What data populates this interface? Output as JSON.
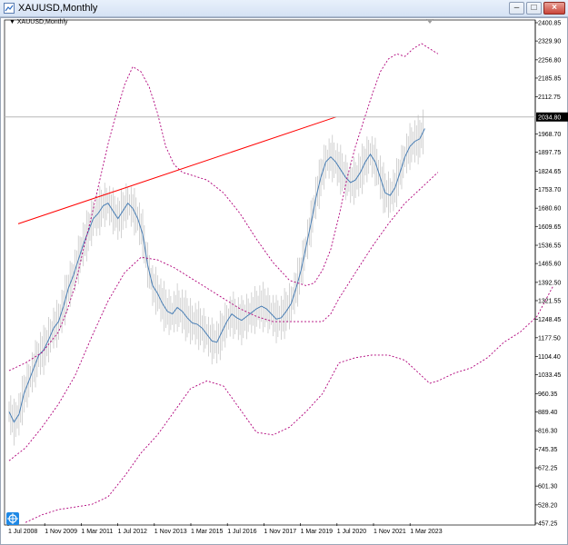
{
  "window": {
    "title": "XAUUSD,Monthly",
    "buttons": [
      "minimize",
      "restore",
      "close"
    ]
  },
  "chart_header": {
    "label": "XAUUSD,Monthly"
  },
  "current_price": "2034.80",
  "chart_data": {
    "type": "line",
    "y_ticks": [
      "2400.85",
      "2329.90",
      "2256.80",
      "2185.85",
      "2112.75",
      "1968.70",
      "1897.75",
      "1824.65",
      "1753.70",
      "1680.60",
      "1609.65",
      "1536.55",
      "1465.60",
      "1392.50",
      "1321.55",
      "1248.45",
      "1177.50",
      "1104.40",
      "1033.45",
      "960.35",
      "889.40",
      "816.30",
      "745.35",
      "672.25",
      "601.30",
      "528.20",
      "457.25"
    ],
    "x_ticks": [
      "1 Jul 2008",
      "1 Nov 2009",
      "1 Mar 2011",
      "1 Jul 2012",
      "1 Nov 2013",
      "1 Mar 2015",
      "1 Jul 2016",
      "1 Nov 2017",
      "1 Mar 2019",
      "1 Jul 2020",
      "1 Nov 2021",
      "1 Mar 2023"
    ],
    "ylim": [
      457.25,
      2400.85
    ],
    "colors": {
      "price_bars": "#c7c7c7",
      "moving_average": "#4a7fb5",
      "bands": "#b0007a",
      "trendline": "#ff0000",
      "price_line": "#b7b7b7",
      "price_label_bg": "#000000"
    },
    "series": [
      {
        "name": "",
        "style": "solid",
        "values": [
          [
            0,
            890
          ],
          [
            3,
            850
          ],
          [
            6,
            880
          ],
          [
            9,
            960
          ],
          [
            12,
            1010
          ],
          [
            15,
            1060
          ],
          [
            18,
            1110
          ],
          [
            21,
            1130
          ],
          [
            24,
            1170
          ],
          [
            27,
            1215
          ],
          [
            30,
            1240
          ],
          [
            33,
            1300
          ],
          [
            36,
            1370
          ],
          [
            39,
            1420
          ],
          [
            42,
            1480
          ],
          [
            45,
            1540
          ],
          [
            48,
            1590
          ],
          [
            51,
            1640
          ],
          [
            54,
            1660
          ],
          [
            57,
            1690
          ],
          [
            60,
            1700
          ],
          [
            63,
            1670
          ],
          [
            66,
            1640
          ],
          [
            69,
            1670
          ],
          [
            72,
            1700
          ],
          [
            75,
            1680
          ],
          [
            78,
            1640
          ],
          [
            81,
            1580
          ],
          [
            84,
            1460
          ],
          [
            87,
            1380
          ],
          [
            90,
            1350
          ],
          [
            93,
            1310
          ],
          [
            96,
            1280
          ],
          [
            99,
            1270
          ],
          [
            102,
            1295
          ],
          [
            105,
            1280
          ],
          [
            108,
            1255
          ],
          [
            111,
            1235
          ],
          [
            114,
            1230
          ],
          [
            117,
            1215
          ],
          [
            120,
            1190
          ],
          [
            123,
            1165
          ],
          [
            126,
            1160
          ],
          [
            129,
            1200
          ],
          [
            132,
            1240
          ],
          [
            135,
            1270
          ],
          [
            138,
            1255
          ],
          [
            141,
            1245
          ],
          [
            144,
            1260
          ],
          [
            147,
            1275
          ],
          [
            150,
            1290
          ],
          [
            153,
            1300
          ],
          [
            156,
            1290
          ],
          [
            159,
            1270
          ],
          [
            162,
            1250
          ],
          [
            165,
            1255
          ],
          [
            168,
            1280
          ],
          [
            171,
            1310
          ],
          [
            174,
            1370
          ],
          [
            177,
            1440
          ],
          [
            180,
            1530
          ],
          [
            183,
            1620
          ],
          [
            186,
            1720
          ],
          [
            189,
            1800
          ],
          [
            192,
            1860
          ],
          [
            195,
            1880
          ],
          [
            198,
            1860
          ],
          [
            201,
            1830
          ],
          [
            204,
            1800
          ],
          [
            207,
            1780
          ],
          [
            210,
            1790
          ],
          [
            213,
            1820
          ],
          [
            216,
            1860
          ],
          [
            219,
            1890
          ],
          [
            222,
            1860
          ],
          [
            225,
            1800
          ],
          [
            228,
            1740
          ],
          [
            231,
            1730
          ],
          [
            234,
            1760
          ],
          [
            237,
            1820
          ],
          [
            240,
            1880
          ],
          [
            243,
            1920
          ],
          [
            246,
            1940
          ],
          [
            249,
            1950
          ],
          [
            252,
            1990
          ]
        ]
      },
      {
        "name": "",
        "style": "dotted",
        "values": [
          [
            0,
            1050
          ],
          [
            10,
            1080
          ],
          [
            20,
            1120
          ],
          [
            30,
            1200
          ],
          [
            35,
            1280
          ],
          [
            40,
            1380
          ],
          [
            45,
            1520
          ],
          [
            50,
            1650
          ],
          [
            55,
            1790
          ],
          [
            60,
            1930
          ],
          [
            65,
            2050
          ],
          [
            70,
            2160
          ],
          [
            75,
            2230
          ],
          [
            80,
            2210
          ],
          [
            85,
            2150
          ],
          [
            90,
            2050
          ],
          [
            95,
            1920
          ],
          [
            100,
            1850
          ],
          [
            105,
            1820
          ],
          [
            110,
            1810
          ],
          [
            120,
            1790
          ],
          [
            130,
            1740
          ],
          [
            140,
            1660
          ],
          [
            150,
            1560
          ],
          [
            160,
            1470
          ],
          [
            170,
            1400
          ],
          [
            180,
            1380
          ],
          [
            185,
            1390
          ],
          [
            190,
            1440
          ],
          [
            195,
            1520
          ],
          [
            200,
            1650
          ],
          [
            205,
            1800
          ],
          [
            210,
            1920
          ],
          [
            215,
            2020
          ],
          [
            220,
            2120
          ],
          [
            225,
            2210
          ],
          [
            230,
            2260
          ],
          [
            235,
            2280
          ],
          [
            240,
            2270
          ],
          [
            245,
            2300
          ],
          [
            250,
            2320
          ],
          [
            255,
            2300
          ],
          [
            260,
            2280
          ]
        ]
      },
      {
        "name": "",
        "style": "dotted",
        "values": [
          [
            0,
            700
          ],
          [
            10,
            750
          ],
          [
            20,
            830
          ],
          [
            30,
            920
          ],
          [
            40,
            1030
          ],
          [
            50,
            1180
          ],
          [
            60,
            1320
          ],
          [
            70,
            1430
          ],
          [
            80,
            1490
          ],
          [
            90,
            1480
          ],
          [
            100,
            1450
          ],
          [
            110,
            1410
          ],
          [
            120,
            1370
          ],
          [
            130,
            1330
          ],
          [
            140,
            1290
          ],
          [
            150,
            1260
          ],
          [
            160,
            1240
          ],
          [
            170,
            1240
          ],
          [
            180,
            1240
          ],
          [
            190,
            1240
          ],
          [
            195,
            1270
          ],
          [
            200,
            1330
          ],
          [
            210,
            1430
          ],
          [
            220,
            1530
          ],
          [
            230,
            1620
          ],
          [
            240,
            1700
          ],
          [
            250,
            1760
          ],
          [
            260,
            1820
          ]
        ]
      },
      {
        "name": "",
        "style": "dotted",
        "values": [
          [
            10,
            460
          ],
          [
            20,
            490
          ],
          [
            30,
            510
          ],
          [
            40,
            520
          ],
          [
            50,
            530
          ],
          [
            60,
            560
          ],
          [
            70,
            640
          ],
          [
            80,
            730
          ],
          [
            90,
            800
          ],
          [
            100,
            890
          ],
          [
            110,
            980
          ],
          [
            120,
            1010
          ],
          [
            130,
            990
          ],
          [
            140,
            900
          ],
          [
            150,
            810
          ],
          [
            160,
            800
          ],
          [
            170,
            830
          ],
          [
            180,
            890
          ],
          [
            190,
            960
          ],
          [
            200,
            1080
          ],
          [
            210,
            1100
          ],
          [
            220,
            1110
          ],
          [
            230,
            1110
          ],
          [
            240,
            1090
          ],
          [
            250,
            1030
          ],
          [
            255,
            1000
          ],
          [
            260,
            1010
          ],
          [
            270,
            1040
          ],
          [
            280,
            1060
          ],
          [
            290,
            1100
          ],
          [
            300,
            1160
          ],
          [
            310,
            1200
          ],
          [
            320,
            1260
          ],
          [
            330,
            1380
          ]
        ]
      },
      {
        "name": "",
        "style": "solid",
        "values": [
          [
            20,
            1620
          ],
          [
            370,
            2035
          ]
        ]
      }
    ]
  }
}
